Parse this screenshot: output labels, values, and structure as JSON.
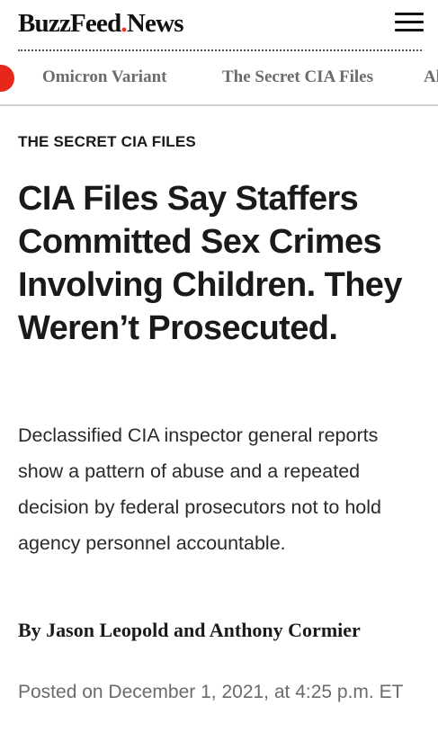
{
  "header": {
    "logo_primary": "BuzzFeed",
    "logo_dot": ".",
    "logo_secondary": "News",
    "menu_icon": "hamburger-menu-icon"
  },
  "topics": {
    "badge_color": "#e8271b",
    "items": [
      {
        "label": "Omicron Variant"
      },
      {
        "label": "The Secret CIA Files"
      },
      {
        "label": "Al"
      }
    ]
  },
  "article": {
    "section_label": "THE SECRET CIA FILES",
    "headline": "CIA Files Say Staffers Committed Sex Crimes Involving Children. They Weren’t Prosecuted.",
    "dek": "Declassified CIA inspector general reports show a pattern of abuse and a repeated decision by federal prosecutors not to hold agency personnel accountable.",
    "byline": "By Jason Leopold and Anthony Cormier",
    "posted": "Posted on December 1, 2021, at 4:25 p.m. ET"
  },
  "colors": {
    "brand_accent": "#ee3322",
    "text_primary": "#1a1a1a",
    "text_muted": "#6b6b6b"
  }
}
